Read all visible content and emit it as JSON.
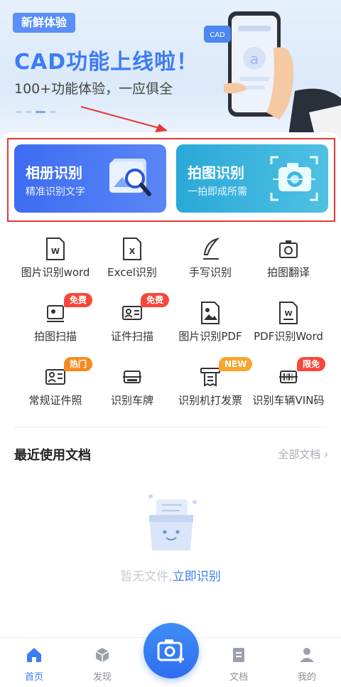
{
  "banner": {
    "tag": "新鲜体验",
    "title": "CAD功能上线啦！",
    "subtitle": "100+功能体验，一应俱全",
    "phone_badge": "CAD"
  },
  "cards": [
    {
      "title": "相册识别",
      "subtitle": "精准识别文字"
    },
    {
      "title": "拍图识别",
      "subtitle": "一拍即成所需"
    }
  ],
  "tools": [
    {
      "label": "图片识别word",
      "icon": "word-doc-icon",
      "badge": ""
    },
    {
      "label": "Excel识别",
      "icon": "excel-doc-icon",
      "badge": ""
    },
    {
      "label": "手写识别",
      "icon": "feather-pen-icon",
      "badge": ""
    },
    {
      "label": "拍图翻译",
      "icon": "photo-translate-icon",
      "badge": ""
    },
    {
      "label": "拍图扫描",
      "icon": "photo-scan-icon",
      "badge": "免费"
    },
    {
      "label": "证件扫描",
      "icon": "id-card-icon",
      "badge": "免费"
    },
    {
      "label": "图片识别PDF",
      "icon": "image-pdf-icon",
      "badge": ""
    },
    {
      "label": "PDF识别Word",
      "icon": "pdf-word-icon",
      "badge": ""
    },
    {
      "label": "常规证件照",
      "icon": "id-photo-icon",
      "badge": "热门"
    },
    {
      "label": "识别车牌",
      "icon": "license-plate-icon",
      "badge": ""
    },
    {
      "label": "识别机打发票",
      "icon": "invoice-icon",
      "badge": "NEW"
    },
    {
      "label": "识别车辆VIN码",
      "icon": "vin-barcode-icon",
      "badge": "限免"
    }
  ],
  "badge_colors": {
    "免费": "#f5483b",
    "热门": "#f58a1f",
    "NEW": "#f7a531",
    "限免": "#f5483b"
  },
  "recent": {
    "title": "最近使用文档",
    "all_link": "全部文档",
    "empty_text": "暂无文件,",
    "empty_action": "立即识别"
  },
  "tabs": [
    {
      "label": "首页",
      "icon": "home-icon",
      "active": true
    },
    {
      "label": "发现",
      "icon": "cube-icon",
      "active": false
    },
    {
      "label": "文档",
      "icon": "document-icon",
      "active": false
    },
    {
      "label": "我的",
      "icon": "user-icon",
      "active": false
    }
  ],
  "colors": {
    "accent": "#3d7cf4",
    "highlight_border": "#e53935"
  }
}
